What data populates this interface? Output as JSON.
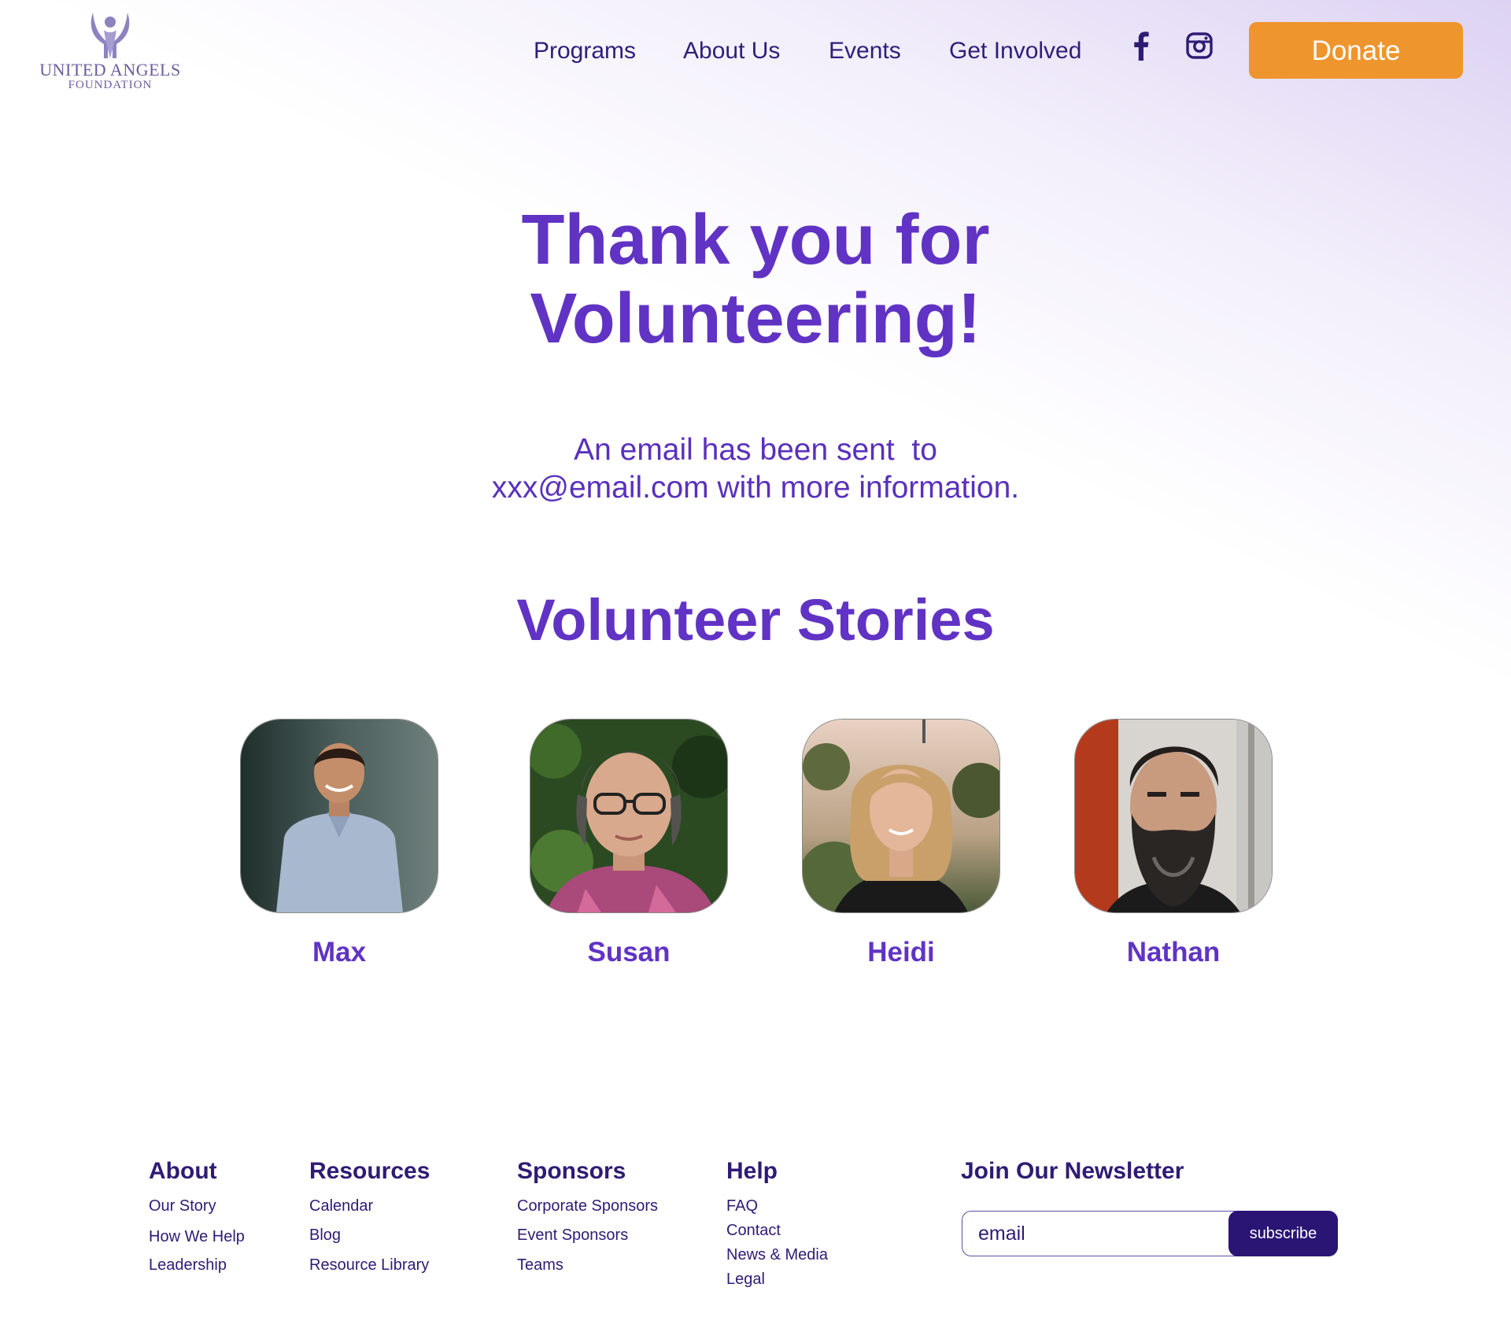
{
  "brand": {
    "name_line1": "UNITED ANGELS",
    "name_line2": "FOUNDATION",
    "logo_icon": "angel-figure-icon",
    "color": "#6c5c9e"
  },
  "nav": {
    "items": [
      {
        "label": "Programs"
      },
      {
        "label": "About Us"
      },
      {
        "label": "Events"
      },
      {
        "label": "Get Involved"
      }
    ],
    "social": [
      {
        "icon": "facebook-icon"
      },
      {
        "icon": "instagram-icon"
      }
    ],
    "donate_label": "Donate"
  },
  "hero": {
    "title_line1": "Thank you for",
    "title_line2": "Volunteering!",
    "message_line1": "An email has been sent  to",
    "message_line2": "xxx@email.com with more information."
  },
  "stories": {
    "title": "Volunteer Stories",
    "people": [
      {
        "name": "Max"
      },
      {
        "name": "Susan"
      },
      {
        "name": "Heidi"
      },
      {
        "name": "Nathan"
      }
    ]
  },
  "footer": {
    "columns": [
      {
        "heading": "About",
        "links": [
          "Our Story",
          "How We Help",
          "Leadership"
        ]
      },
      {
        "heading": "Resources",
        "links": [
          "Calendar",
          "Blog",
          "Resource Library"
        ]
      },
      {
        "heading": "Sponsors",
        "links": [
          "Corporate Sponsors",
          "Event Sponsors",
          "Teams"
        ]
      },
      {
        "heading": "Help",
        "links": [
          "FAQ",
          "Contact",
          "News & Media",
          "Legal"
        ]
      }
    ],
    "newsletter": {
      "heading": "Join Our Newsletter",
      "placeholder": "email",
      "button_label": "subscribe"
    }
  },
  "colors": {
    "primary": "#6033c4",
    "navy": "#2f1b74",
    "accent": "#ef952e",
    "button_dark": "#2a1575"
  }
}
